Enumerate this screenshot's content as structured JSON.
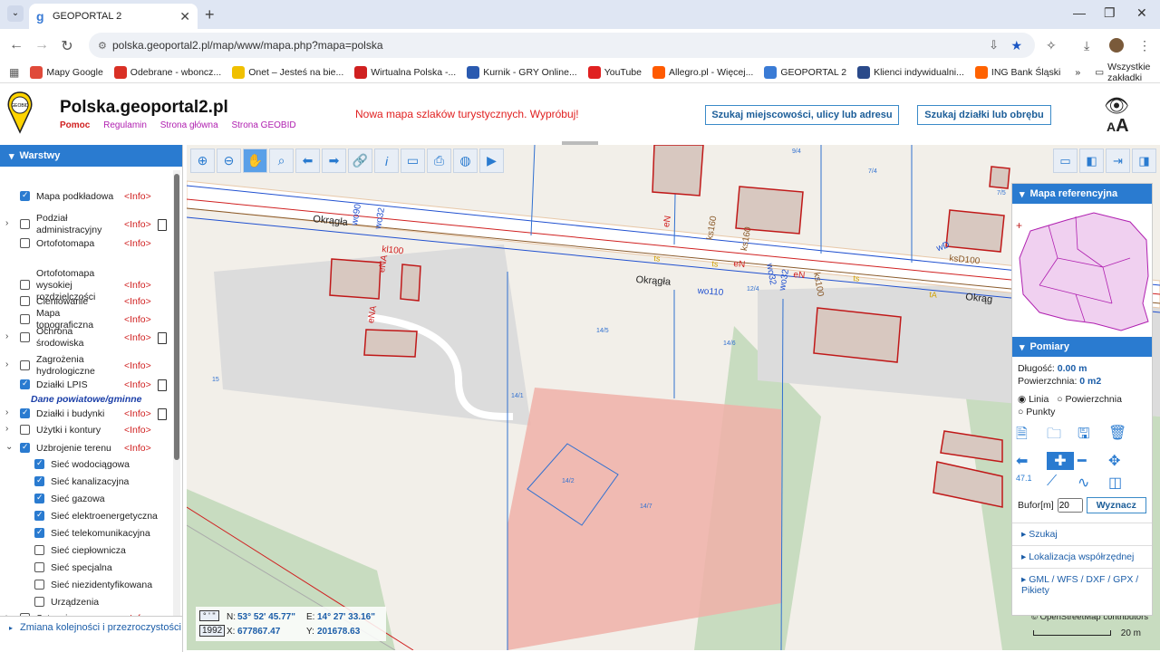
{
  "browser": {
    "tab_title": "GEOPORTAL 2",
    "url": "polska.geoportal2.pl/map/www/mapa.php?mapa=polska",
    "bookmarks": [
      {
        "label": "Mapy Google",
        "color": "#e04a3a",
        "icon": "map-pin-icon"
      },
      {
        "label": "Odebrane - wboncz...",
        "color": "#d93025",
        "icon": "gmail-icon"
      },
      {
        "label": "Onet – Jesteś na bie...",
        "color": "#f0c000",
        "icon": "onet-icon"
      },
      {
        "label": "Wirtualna Polska -...",
        "color": "#d02020",
        "icon": "wp-icon"
      },
      {
        "label": "Kurnik - GRY Online...",
        "color": "#2a5ab0",
        "icon": "star-icon"
      },
      {
        "label": "YouTube",
        "color": "#e02020",
        "icon": "youtube-icon"
      },
      {
        "label": "Allegro.pl - Więcej...",
        "color": "#ff5a00",
        "icon": "allegro-icon"
      },
      {
        "label": "GEOPORTAL 2",
        "color": "#3a7bd5",
        "icon": "geoportal-icon"
      },
      {
        "label": "Klienci indywidualni...",
        "color": "#2a4a8a",
        "icon": "bank-icon"
      },
      {
        "label": "ING Bank Śląski",
        "color": "#ff6200",
        "icon": "ing-icon"
      }
    ],
    "more_bookmarks": "»",
    "all_bookmarks": "Wszystkie zakładki"
  },
  "header": {
    "site_title": "Polska.geoportal2.pl",
    "links": [
      "Pomoc",
      "Regulamin",
      "Strona główna",
      "Strona GEOBID"
    ],
    "logo_text": "GEOBID",
    "promo": "Nowa mapa szlaków turystycznych. Wypróbuj!",
    "search_address": "Szukaj miejscowości, ulicy lub adresu",
    "search_parcel": "Szukaj działki lub obrębu",
    "font_toggle": "AA"
  },
  "layers_panel": {
    "title": "Warstwy",
    "info_label": "<Info>",
    "section_note": "Dane powiatowe/gminne",
    "items": [
      {
        "label": "Mapa podkładowa",
        "checked": true,
        "info": true
      },
      {
        "label": "Podział administracyjny",
        "checked": false,
        "info": true,
        "expandable": true,
        "doc": true
      },
      {
        "label": "Ortofotomapa",
        "checked": false,
        "info": true
      },
      {
        "label": "Ortofotomapa wysokiej rozdzielczości",
        "checked": false,
        "info": true
      },
      {
        "label": "Cieniowanie",
        "checked": false,
        "info": true
      },
      {
        "label": "Mapa topograficzna",
        "checked": false,
        "info": true
      },
      {
        "label": "Ochrona środowiska",
        "checked": false,
        "info": true,
        "expandable": true,
        "doc": true
      },
      {
        "label": "Zagrożenia hydrologiczne",
        "checked": false,
        "info": true,
        "expandable": true
      },
      {
        "label": "Działki LPIS",
        "checked": true,
        "info": true,
        "doc": true
      },
      {
        "label": "Działki i budynki",
        "checked": true,
        "info": true,
        "expandable": true,
        "doc": true
      },
      {
        "label": "Użytki i kontury",
        "checked": false,
        "info": true,
        "expandable": true
      },
      {
        "label": "Uzbrojenie terenu",
        "checked": true,
        "info": true,
        "expanded": true
      }
    ],
    "subitems": [
      {
        "label": "Sieć wodociągowa",
        "checked": true
      },
      {
        "label": "Sieć kanalizacyjna",
        "checked": true
      },
      {
        "label": "Sieć gazowa",
        "checked": true
      },
      {
        "label": "Sieć elektroenergetyczna",
        "checked": true
      },
      {
        "label": "Sieć telekomunikacyjna",
        "checked": true
      },
      {
        "label": "Sieć ciepłownicza",
        "checked": false
      },
      {
        "label": "Sieć specjalna",
        "checked": false
      },
      {
        "label": "Sieć niezidentyfikowana",
        "checked": false
      },
      {
        "label": "Urządzenia",
        "checked": false
      }
    ],
    "last_item": "Sytuacja",
    "footer_link": "Zmiana kolejności i przezroczystości"
  },
  "map": {
    "street_name": "Okrągła",
    "labels": [
      "Okrągła",
      "Okrągła",
      "Okrąg",
      "wo90",
      "wo32",
      "kl100",
      "eNA",
      "eNA",
      "eN",
      "ks160",
      "ks160",
      "wo32",
      "wo32",
      "eN",
      "eN",
      "ks100",
      "wo110",
      "ksD100",
      "wD",
      "ts",
      "ts",
      "ts",
      "tA"
    ],
    "parcels": [
      "14/5",
      "14/6",
      "14/1",
      "14/2",
      "14/7",
      "15",
      "9/4",
      "7/4",
      "7/5",
      "12/4"
    ],
    "coords": {
      "format_a": "° ' \"",
      "format_b": "1992",
      "n_label": "N:",
      "n_value": "53° 52' 45.77\"",
      "e_label": "E:",
      "e_value": "14° 27' 33.16\"",
      "x_label": "X:",
      "x_value": "677867.47",
      "y_label": "Y:",
      "y_value": "201678.63"
    },
    "attribution": "© OpenStreetMap contributors",
    "scale": "20 m"
  },
  "right_panel": {
    "ref_map_title": "Mapa referencyjna",
    "measure_title": "Pomiary",
    "length_label": "Długość:",
    "length_value": "0.00 m",
    "area_label": "Powierzchnia:",
    "area_value": "0 m2",
    "radio_line": "Linia",
    "radio_area": "Powierzchnia",
    "radio_points": "Punkty",
    "buffer_label": "Bufor[m]",
    "buffer_value": "20",
    "compute_button": "Wyznacz",
    "tool_label": "47.1",
    "sections": [
      "Szukaj",
      "Lokalizacja współrzędnej",
      "GML / WFS / DXF / GPX / Pikiety"
    ]
  }
}
